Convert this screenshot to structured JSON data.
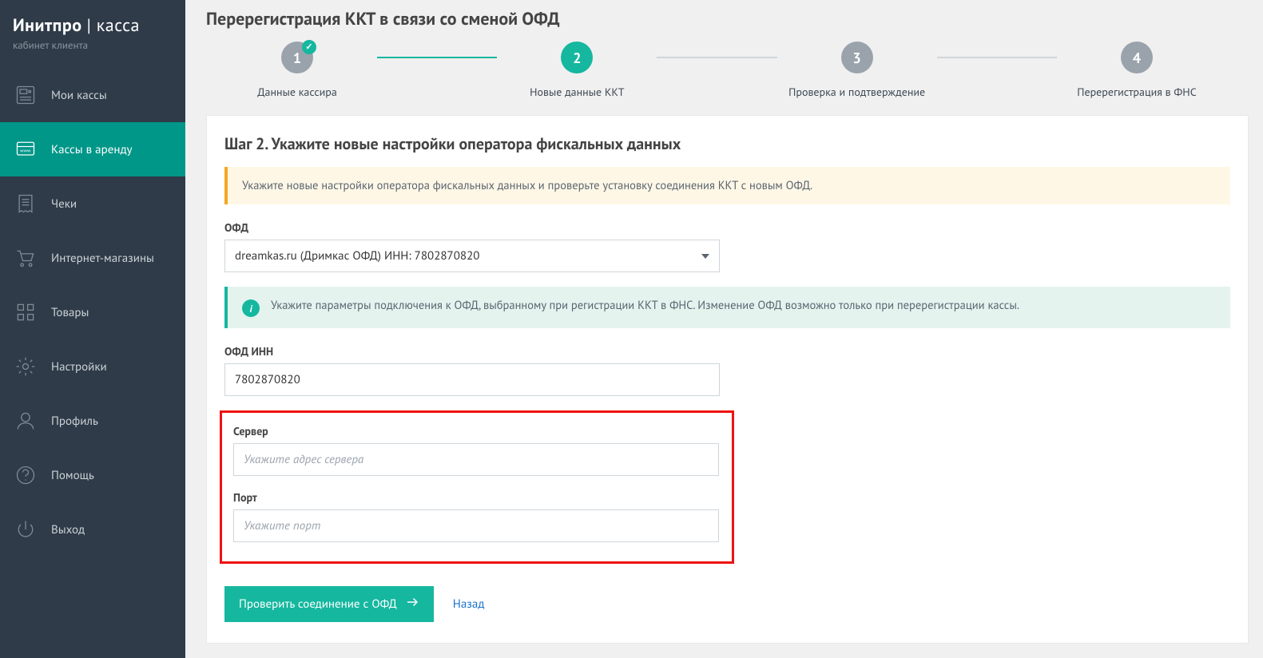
{
  "brand": {
    "name1": "Инитпро",
    "name2": "касса",
    "sub": "кабинет клиента"
  },
  "sidebar": {
    "items": [
      {
        "label": "Мои кассы"
      },
      {
        "label": "Кассы в аренду"
      },
      {
        "label": "Чеки"
      },
      {
        "label": "Интернет-магазины"
      },
      {
        "label": "Товары"
      },
      {
        "label": "Настройки"
      },
      {
        "label": "Профиль"
      },
      {
        "label": "Помощь"
      }
    ],
    "exit": "Выход"
  },
  "page": {
    "title": "Перерегистрация ККТ в связи со сменой ОФД"
  },
  "stepper": [
    {
      "num": "1",
      "label": "Данные кассира"
    },
    {
      "num": "2",
      "label": "Новые данные ККТ"
    },
    {
      "num": "3",
      "label": "Проверка и подтверждение"
    },
    {
      "num": "4",
      "label": "Перерегистрация в ФНС"
    }
  ],
  "card": {
    "title": "Шаг 2. Укажите новые настройки оператора фискальных данных",
    "warn": "Укажите новые настройки оператора фискальных данных и проверьте установку соединения ККТ с новым ОФД.",
    "ofd_label": "ОФД",
    "ofd_value": "dreamkas.ru (Дримкас ОФД) ИНН: 7802870820",
    "info": "Укажите параметры подключения к ОФД, выбранному при регистрации ККТ в ФНС. Изменение ОФД возможно только при перерегистрации кассы.",
    "inn_label": "ОФД ИНН",
    "inn_value": "7802870820",
    "server_label": "Сервер",
    "server_placeholder": "Укажите адрес сервера",
    "port_label": "Порт",
    "port_placeholder": "Укажите порт",
    "submit": "Проверить соединение с ОФД",
    "back": "Назад"
  }
}
